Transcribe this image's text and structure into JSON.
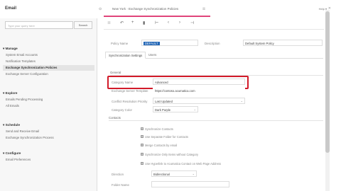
{
  "app": {
    "title": "Email",
    "top_right": "Help ▾",
    "top_close": "✕"
  },
  "sidebar": {
    "search_placeholder": "Type your query here",
    "search_button": "Search",
    "groups": [
      {
        "label": "Manage",
        "items": [
          "System Email Accounts",
          "Notification Templates",
          "Exchange Synchronization Policies",
          "Exchange Server Configuration"
        ]
      },
      {
        "label": "Explore",
        "items": [
          "Emails Pending Processing",
          "All Emails"
        ]
      },
      {
        "label": "Schedule",
        "items": [
          "Send and Receive Email",
          "Exchange Synchronization Process"
        ]
      },
      {
        "label": "Configure",
        "items": [
          "Email Preferences"
        ]
      }
    ]
  },
  "tab": {
    "parent": "New York",
    "separator": "›",
    "current": "Exchange Synchronization Policies",
    "close": "☒"
  },
  "toolbar": {
    "icons": [
      "≣",
      "↶",
      "+",
      "▮",
      "⊢",
      "‹",
      "›",
      "⊣"
    ]
  },
  "form": {
    "policy_name_label": "Policy Name",
    "policy_name_value": "DEFAULT",
    "description_label": "Description",
    "description_value": "Default System Policy",
    "subtabs": [
      "Synchronization Settings",
      "Users"
    ],
    "section_general": "General",
    "category_name_label": "Category Name",
    "category_name_value": "Advanced",
    "url_label": "Exchange Server Template",
    "url_value": "https://contoso.acumatica.com",
    "conflict_label": "Conflict Resolution Priority",
    "conflict_value": "Last Updated",
    "category_color_label": "Category Color",
    "category_color_value": "Dark Purple",
    "section_contacts": "Contacts",
    "checkboxes": [
      "Synchronize Contacts",
      "Use Separate Folder for Contacts",
      "Merge Contacts by email",
      "Synchronize Only Items without Category",
      "Use Hyperlink to Acumatica Contact on Web Page Address"
    ],
    "direction_label": "Direction",
    "direction_value": "Bidirectional",
    "folder_label": "Folder Name"
  },
  "colors": {
    "accent": "#e0457b",
    "highlight": "#d21b2a",
    "selection": "#1f64b5"
  }
}
